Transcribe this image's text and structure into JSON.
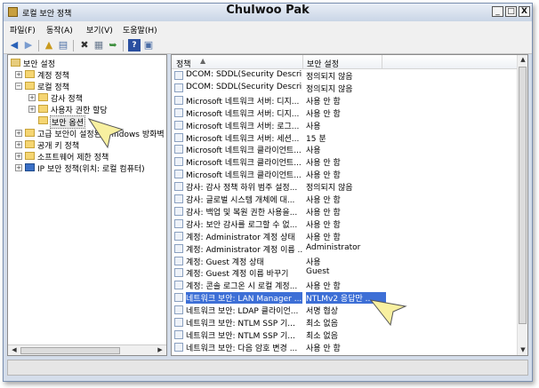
{
  "window": {
    "title": "로컬 보안 정책",
    "author": "Chulwoo Pak",
    "minimize": "_",
    "maximize": "□",
    "close": "X"
  },
  "menu": [
    "파일(F)",
    "동작(A)",
    "보기(V)",
    "도움말(H)"
  ],
  "toolbar": {
    "icons": [
      "back-arrow-icon",
      "forward-arrow-icon",
      "up-folder-icon",
      "show-hide-tree-icon",
      "delete-icon",
      "properties-icon",
      "export-list-icon",
      "help-icon",
      "view-icon"
    ]
  },
  "tree": {
    "root": "보안 설정",
    "account_policies": "계정 정책",
    "local_policies": "로컬 정책",
    "audit_policy": "감사 정책",
    "user_rights": "사용자 권한 할당",
    "security_options": "보안 옵션",
    "windows_firewall": "고급 보안이 설정된 Windows 방화벽",
    "public_key": "공개 키 정책",
    "software_restriction": "소프트웨어 제한 정책",
    "ip_security": "IP 보안 정책(위치: 로컬 컴퓨터)"
  },
  "columns": {
    "policy": "정책",
    "setting": "보안 설정"
  },
  "rows": [
    {
      "policy": "DCOM: SDDL(Security Descrip...",
      "setting": "정의되지 않음"
    },
    {
      "policy": "DCOM: SDDL(Security Descrip...",
      "setting": "정의되지 않음"
    },
    {
      "policy": "Microsoft 네트워크 서버: 디지...",
      "setting": "사용 안 함"
    },
    {
      "policy": "Microsoft 네트워크 서버: 디지...",
      "setting": "사용 안 함"
    },
    {
      "policy": "Microsoft 네트워크 서버: 로그...",
      "setting": "사용"
    },
    {
      "policy": "Microsoft 네트워크 서버: 세션...",
      "setting": "15 분"
    },
    {
      "policy": "Microsoft 네트워크 클라이언트...",
      "setting": "사용"
    },
    {
      "policy": "Microsoft 네트워크 클라이언트...",
      "setting": "사용 안 함"
    },
    {
      "policy": "Microsoft 네트워크 클라이언트...",
      "setting": "사용 안 함"
    },
    {
      "policy": "감사: 감사 정책 하위 범주 설정...",
      "setting": "정의되지 않음"
    },
    {
      "policy": "감사: 글로벌 시스템 개체에 대...",
      "setting": "사용 안 함"
    },
    {
      "policy": "감사: 백업 및 복원 권한 사용을...",
      "setting": "사용 안 함"
    },
    {
      "policy": "감사: 보안 감사를 로그할 수 없...",
      "setting": "사용 안 함"
    },
    {
      "policy": "계정: Administrator 계정 상태",
      "setting": "사용 안 함"
    },
    {
      "policy": "계정: Administrator 계정 이름 ...",
      "setting": "Administrator"
    },
    {
      "policy": "계정: Guest 계정 상태",
      "setting": "사용"
    },
    {
      "policy": "계정: Guest 계정 이름 바꾸기",
      "setting": "Guest"
    },
    {
      "policy": "계정: 콘솔 로그온 시 로컬 계정...",
      "setting": "사용 안 함"
    },
    {
      "policy": "네트워크 보안: LAN Manager ...",
      "setting": "NTLMv2 응답만 ..."
    },
    {
      "policy": "네트워크 보안: LDAP 클라이언...",
      "setting": "서명 협상"
    },
    {
      "policy": "네트워크 보안: NTLM SSP 기...",
      "setting": "최소 없음"
    },
    {
      "policy": "네트워크 보안: NTLM SSP 기...",
      "setting": "최소 없음"
    },
    {
      "policy": "네트워크 보안: 다음 암호 변경 ...",
      "setting": "사용 안 함"
    }
  ],
  "highlight_color": "#3d6fd6",
  "callout_color": "#f8f0a0"
}
